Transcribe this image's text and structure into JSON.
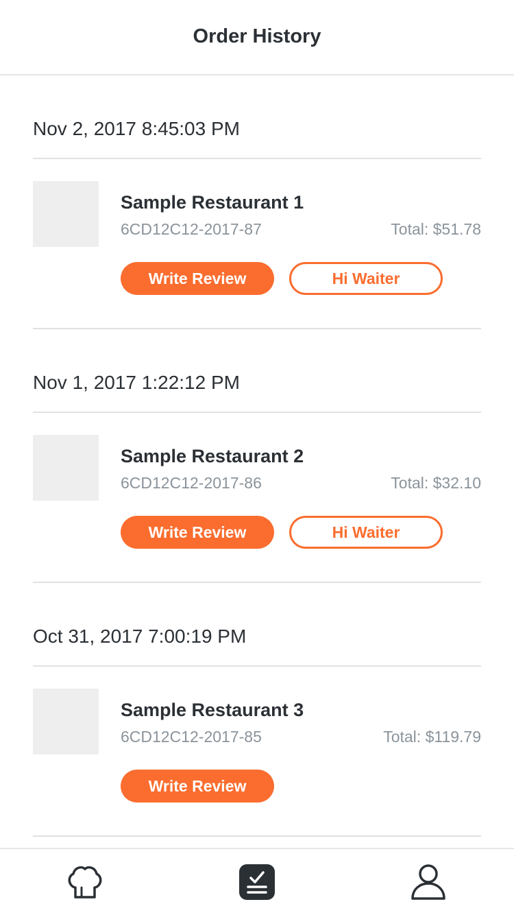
{
  "header": {
    "title": "Order History"
  },
  "orders": [
    {
      "date": "Nov 2, 2017 8:45:03 PM",
      "restaurant": "Sample Restaurant 1",
      "code": "6CD12C12-2017-87",
      "total": "Total: $51.78",
      "review_label": "Write Review",
      "waiter_label": "Hi Waiter"
    },
    {
      "date": "Nov 1, 2017 1:22:12 PM",
      "restaurant": "Sample Restaurant 2",
      "code": "6CD12C12-2017-86",
      "total": "Total: $32.10",
      "review_label": "Write Review",
      "waiter_label": "Hi Waiter"
    },
    {
      "date": "Oct 31, 2017 7:00:19 PM",
      "restaurant": "Sample Restaurant 3",
      "code": "6CD12C12-2017-85",
      "total": "Total: $119.79",
      "review_label": "Write Review"
    }
  ],
  "tabbar": {
    "items": [
      {
        "icon": "chef-hat-icon",
        "active": false
      },
      {
        "icon": "order-list-icon",
        "active": true
      },
      {
        "icon": "user-icon",
        "active": false
      }
    ]
  },
  "colors": {
    "accent": "#fa6d2f",
    "text": "#2b3035",
    "muted": "#8a939b",
    "divider": "#e1e1e1",
    "placeholder": "#eeeeee"
  }
}
